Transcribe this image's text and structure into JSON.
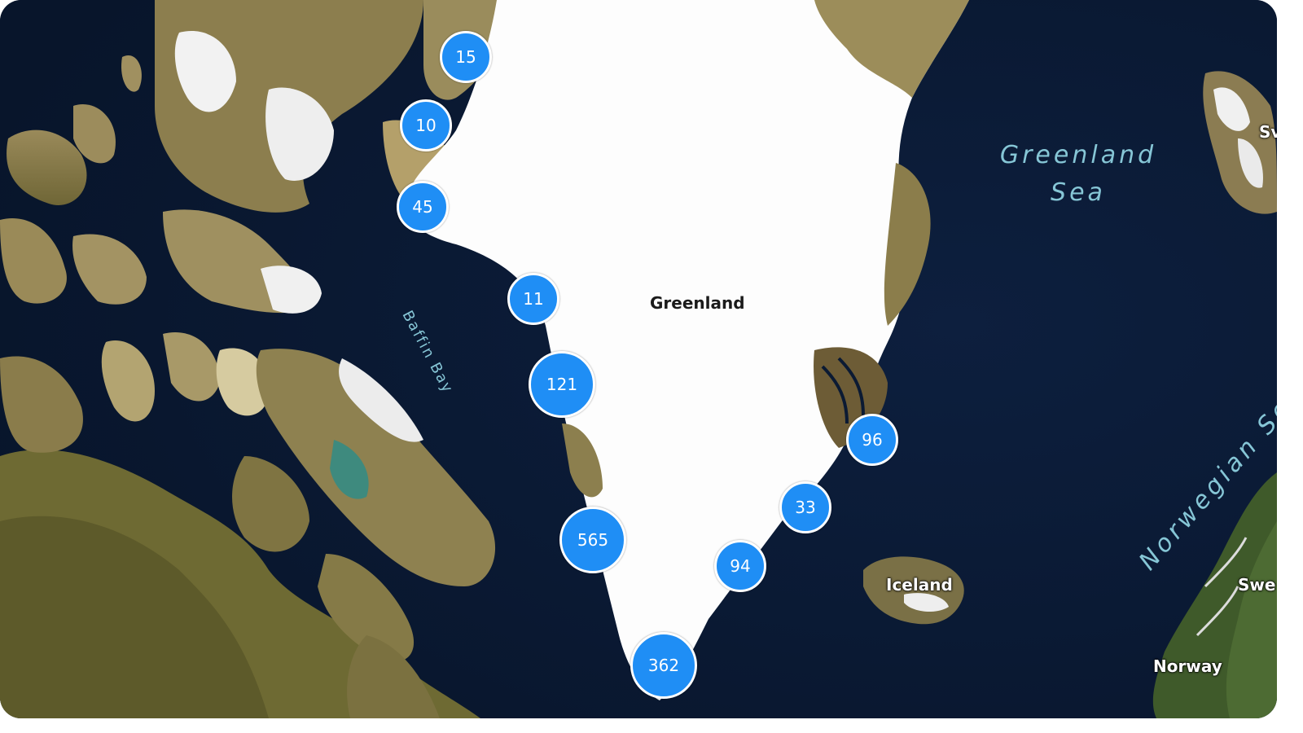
{
  "map": {
    "colors": {
      "ocean": "#0b1a33",
      "ice": "#ffffff",
      "land": "#8a7a4a",
      "cluster": "#1f8ef5",
      "sea_label": "#86c6d6"
    },
    "labels": {
      "greenland": "Greenland",
      "iceland": "Iceland",
      "norway": "Norway",
      "sweden_edge": "Swe",
      "sweden_top_edge": "Sv",
      "greenland_sea_line1": "Greenland",
      "greenland_sea_line2": "Sea",
      "baffin_bay": "Baffin Bay",
      "norwegian_sea": "Norwegian Sea"
    },
    "clusters": [
      {
        "count": "15"
      },
      {
        "count": "10"
      },
      {
        "count": "45"
      },
      {
        "count": "11"
      },
      {
        "count": "121"
      },
      {
        "count": "96"
      },
      {
        "count": "33"
      },
      {
        "count": "565"
      },
      {
        "count": "94"
      },
      {
        "count": "362"
      }
    ]
  }
}
